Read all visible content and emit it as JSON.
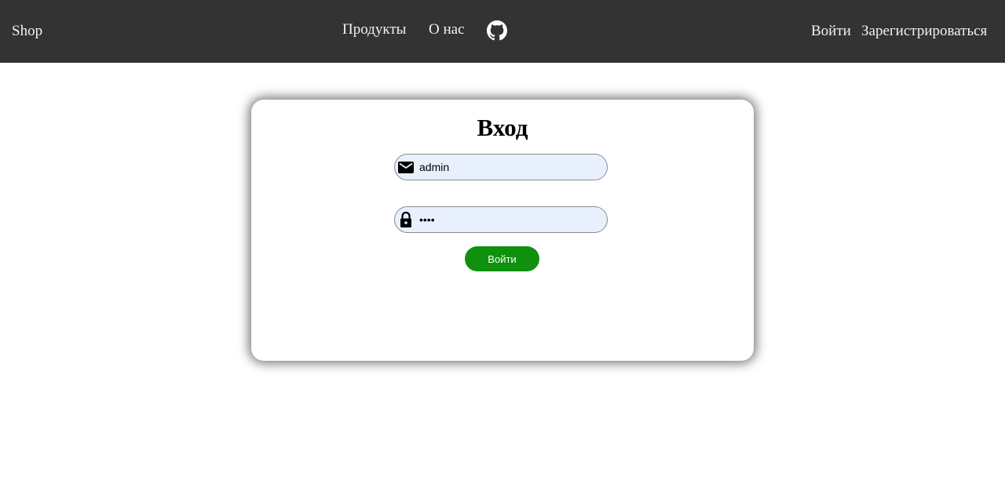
{
  "navbar": {
    "brand": "Shop",
    "links": {
      "products": "Продукты",
      "about": "О нас",
      "github_icon": "github-icon"
    },
    "auth": {
      "login": "Войти",
      "register": "Зарегистрироваться"
    },
    "background_color": "#333333",
    "text_color": "#f2f2f2"
  },
  "login_form": {
    "title": "Вход",
    "email": {
      "icon": "envelope-icon",
      "value": "admin"
    },
    "password": {
      "icon": "lock-icon",
      "value": "1234"
    },
    "submit_label": "Войти",
    "submit_color": "#0f910f",
    "field_background": "#e8f0fe"
  }
}
